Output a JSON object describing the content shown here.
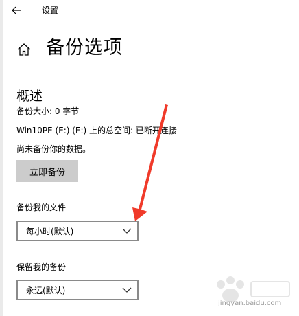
{
  "header": {
    "back_icon": "arrow-left-icon",
    "title": "设置"
  },
  "page": {
    "home_icon": "home-icon",
    "title": "备份选项"
  },
  "overview": {
    "heading": "概述",
    "backup_size": "备份大小: 0 字节",
    "total_space": "Win10PE (E:) (E:) 上的总空间: 已断开连接",
    "not_backed_up": "尚未备份你的数据。",
    "backup_now_label": "立即备份"
  },
  "backup_files": {
    "label": "备份我的文件",
    "selected": "每小时(默认)"
  },
  "keep_backups": {
    "label": "保留我的备份",
    "selected": "永远(默认)"
  },
  "annotation": {
    "arrow_color": "#f03a2a"
  },
  "watermark": {
    "logo": "Baidu 经验",
    "text": "jingyan.baidu.com"
  }
}
